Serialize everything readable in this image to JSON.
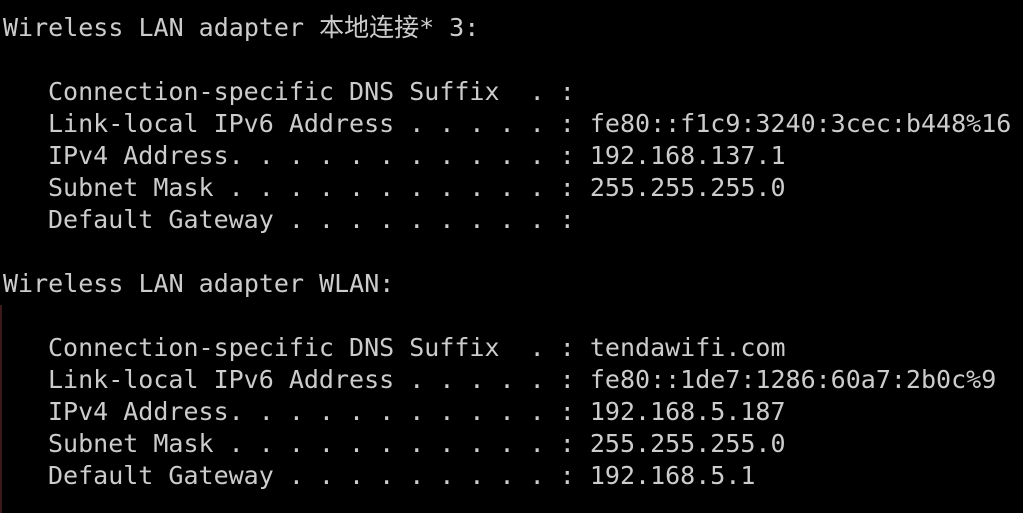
{
  "console": {
    "adapters": [
      {
        "header": "Wireless LAN adapter 本地连接* 3:",
        "fields": [
          {
            "label": "Connection-specific DNS Suffix  . :",
            "value": ""
          },
          {
            "label": "Link-local IPv6 Address . . . . . :",
            "value": "fe80::f1c9:3240:3cec:b448%16"
          },
          {
            "label": "IPv4 Address. . . . . . . . . . . :",
            "value": "192.168.137.1"
          },
          {
            "label": "Subnet Mask . . . . . . . . . . . :",
            "value": "255.255.255.0"
          },
          {
            "label": "Default Gateway . . . . . . . . . :",
            "value": ""
          }
        ]
      },
      {
        "header": "Wireless LAN adapter WLAN:",
        "fields": [
          {
            "label": "Connection-specific DNS Suffix  . :",
            "value": "tendawifi.com"
          },
          {
            "label": "Link-local IPv6 Address . . . . . :",
            "value": "fe80::1de7:1286:60a7:2b0c%9"
          },
          {
            "label": "IPv4 Address. . . . . . . . . . . :",
            "value": "192.168.5.187"
          },
          {
            "label": "Subnet Mask . . . . . . . . . . . :",
            "value": "255.255.255.0"
          },
          {
            "label": "Default Gateway . . . . . . . . . :",
            "value": "192.168.5.1"
          }
        ]
      }
    ]
  },
  "colors": {
    "background": "#000000",
    "text": "#cccccc"
  }
}
